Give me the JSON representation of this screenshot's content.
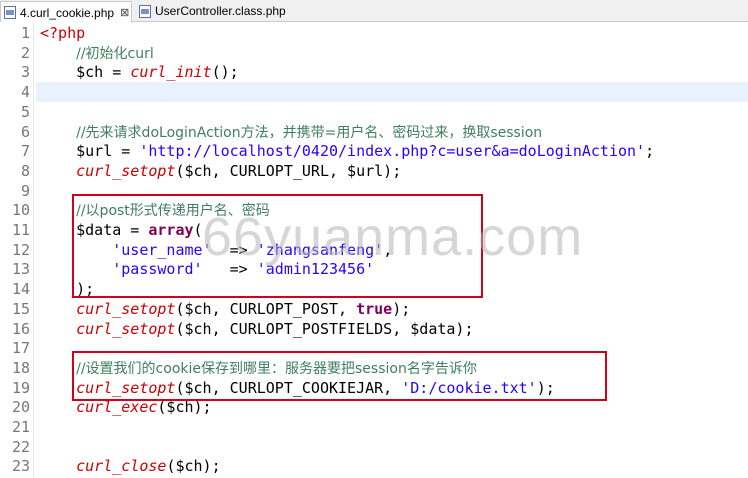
{
  "tabs": [
    {
      "label": "4.curl_cookie.php",
      "close": "⊠",
      "active": true
    },
    {
      "label": "UserController.class.php",
      "active": false
    }
  ],
  "watermark": "66yuanma.com",
  "colors": {
    "keyword": "#7f0055",
    "function": "#cc0000",
    "string": "#2a00ff",
    "comment": "#3f7f5f",
    "highlight_box": "#d0021b"
  },
  "lines": [
    {
      "n": "1",
      "t": [
        [
          "php",
          "<?php"
        ]
      ]
    },
    {
      "n": "2",
      "t": [
        [
          "txt",
          "    "
        ],
        [
          "cm",
          "//初始化curl"
        ]
      ]
    },
    {
      "n": "3",
      "t": [
        [
          "txt",
          "    $ch = "
        ],
        [
          "fn",
          "curl_init"
        ],
        [
          "txt",
          "();"
        ]
      ]
    },
    {
      "n": "4",
      "t": []
    },
    {
      "n": "5",
      "t": []
    },
    {
      "n": "6",
      "t": [
        [
          "txt",
          "    "
        ],
        [
          "cm",
          "//先来请求doLoginAction方法，并携带=用户名、密码过来，换取session"
        ]
      ]
    },
    {
      "n": "7",
      "t": [
        [
          "txt",
          "    $url = "
        ],
        [
          "str",
          "'http://localhost/0420/index.php?c=user&a=doLoginAction'"
        ],
        [
          "txt",
          ";"
        ]
      ]
    },
    {
      "n": "8",
      "t": [
        [
          "txt",
          "    "
        ],
        [
          "fn",
          "curl_setopt"
        ],
        [
          "txt",
          "($ch, CURLOPT_URL, $url);"
        ]
      ]
    },
    {
      "n": "9",
      "t": []
    },
    {
      "n": "10",
      "t": [
        [
          "txt",
          "    "
        ],
        [
          "cm",
          "//以post形式传递用户名、密码"
        ]
      ]
    },
    {
      "n": "11",
      "t": [
        [
          "txt",
          "    $data = "
        ],
        [
          "kw",
          "array"
        ],
        [
          "txt",
          "("
        ]
      ]
    },
    {
      "n": "12",
      "t": [
        [
          "txt",
          "        "
        ],
        [
          "str",
          "'user_name'"
        ],
        [
          "txt",
          "  => "
        ],
        [
          "str",
          "'zhangsanfeng'"
        ],
        [
          "txt",
          ","
        ]
      ]
    },
    {
      "n": "13",
      "t": [
        [
          "txt",
          "        "
        ],
        [
          "str",
          "'password'"
        ],
        [
          "txt",
          "   => "
        ],
        [
          "str",
          "'admin123456'"
        ]
      ]
    },
    {
      "n": "14",
      "t": [
        [
          "txt",
          "    );"
        ]
      ]
    },
    {
      "n": "15",
      "t": [
        [
          "txt",
          "    "
        ],
        [
          "fn",
          "curl_setopt"
        ],
        [
          "txt",
          "($ch, CURLOPT_POST, "
        ],
        [
          "kw",
          "true"
        ],
        [
          "txt",
          ");"
        ]
      ]
    },
    {
      "n": "16",
      "t": [
        [
          "txt",
          "    "
        ],
        [
          "fn",
          "curl_setopt"
        ],
        [
          "txt",
          "($ch, CURLOPT_POSTFIELDS, $data);"
        ]
      ]
    },
    {
      "n": "17",
      "t": []
    },
    {
      "n": "18",
      "t": [
        [
          "txt",
          "    "
        ],
        [
          "cm",
          "//设置我们的cookie保存到哪里：服务器要把session名字告诉你"
        ]
      ]
    },
    {
      "n": "19",
      "t": [
        [
          "txt",
          "    "
        ],
        [
          "fn",
          "curl_setopt"
        ],
        [
          "txt",
          "($ch, CURLOPT_COOKIEJAR, "
        ],
        [
          "str",
          "'D:/cookie.txt'"
        ],
        [
          "txt",
          ");"
        ]
      ]
    },
    {
      "n": "20",
      "t": [
        [
          "txt",
          "    "
        ],
        [
          "fn",
          "curl_exec"
        ],
        [
          "txt",
          "($ch);"
        ]
      ]
    },
    {
      "n": "21",
      "t": []
    },
    {
      "n": "22",
      "t": []
    },
    {
      "n": "23",
      "t": [
        [
          "txt",
          "    "
        ],
        [
          "fn",
          "curl_close"
        ],
        [
          "txt",
          "($ch);"
        ]
      ]
    }
  ],
  "current_line": "4"
}
